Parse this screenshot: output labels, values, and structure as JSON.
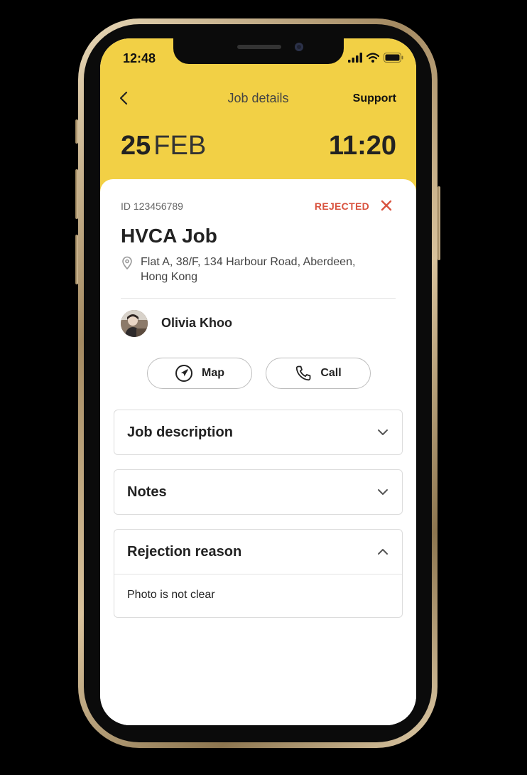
{
  "status_bar": {
    "time": "12:48"
  },
  "nav": {
    "title": "Job details",
    "support_label": "Support"
  },
  "schedule": {
    "day": "25",
    "month": "FEB",
    "time": "11:20"
  },
  "job": {
    "id_text": "ID 123456789",
    "status": "REJECTED",
    "title": "HVCA Job",
    "address": "Flat A, 38/F, 134 Harbour Road, Aberdeen, Hong Kong"
  },
  "contact": {
    "name": "Olivia Khoo"
  },
  "actions": {
    "map_label": "Map",
    "call_label": "Call"
  },
  "sections": {
    "description_title": "Job description",
    "notes_title": "Notes",
    "rejection_title": "Rejection reason",
    "rejection_text": "Photo is not clear"
  },
  "colors": {
    "accent": "#f2d045",
    "rejected": "#d9533f"
  }
}
